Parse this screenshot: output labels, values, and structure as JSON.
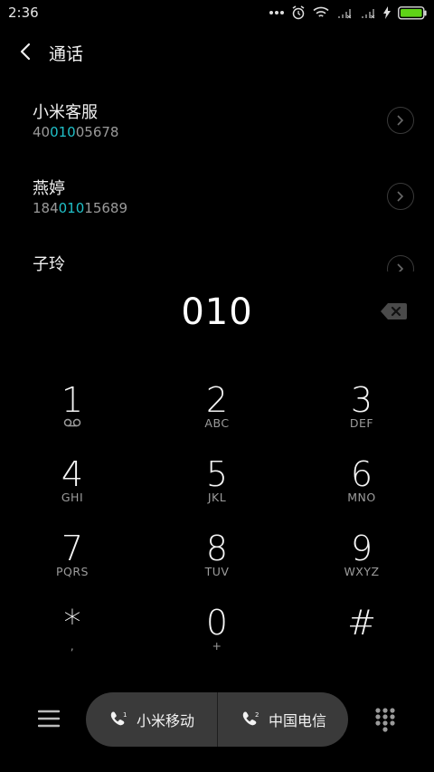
{
  "status": {
    "time": "2:36"
  },
  "header": {
    "title": "通话"
  },
  "results": [
    {
      "name": "小米客服",
      "number_pre": "40",
      "number_match": "010",
      "number_post": "05678"
    },
    {
      "name": "燕婷",
      "number_pre": "184",
      "number_match": "010",
      "number_post": "15689"
    },
    {
      "name": "子玲"
    }
  ],
  "dialed": "010",
  "keypad": [
    {
      "num": "1",
      "letters": ""
    },
    {
      "num": "2",
      "letters": "ABC"
    },
    {
      "num": "3",
      "letters": "DEF"
    },
    {
      "num": "4",
      "letters": "GHI"
    },
    {
      "num": "5",
      "letters": "JKL"
    },
    {
      "num": "6",
      "letters": "MNO"
    },
    {
      "num": "7",
      "letters": "PQRS"
    },
    {
      "num": "8",
      "letters": "TUV"
    },
    {
      "num": "9",
      "letters": "WXYZ"
    },
    {
      "num": "*",
      "letters": ","
    },
    {
      "num": "0",
      "letters": "+"
    },
    {
      "num": "#",
      "letters": ""
    }
  ],
  "sims": [
    {
      "slot": "1",
      "label": "小米移动"
    },
    {
      "slot": "2",
      "label": "中国电信"
    }
  ],
  "colors": {
    "highlight": "#20c0c8",
    "battery": "#5fd317"
  },
  "icons": [
    "more-dots-icon",
    "alarm-icon",
    "wifi-icon",
    "signal-icon",
    "charging-icon",
    "battery-icon",
    "back-arrow-icon",
    "chevron-right-icon",
    "backspace-icon",
    "voicemail-icon",
    "menu-icon",
    "phone-icon",
    "dialpad-icon"
  ]
}
